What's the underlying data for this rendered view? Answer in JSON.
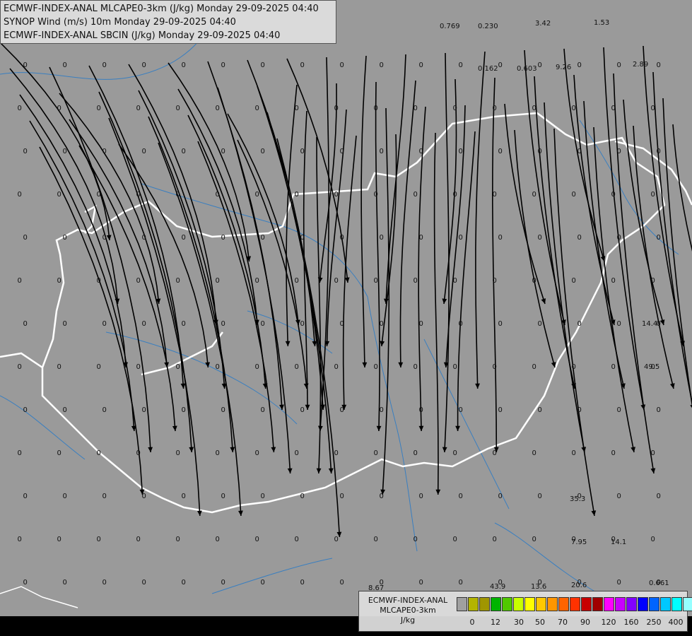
{
  "header": {
    "line1": "ECMWF-INDEX-ANAL MLCAPE0-3km (J/kg) Monday 29-09-2025 04:40",
    "line2": "SYNOP Wind (m/s) 10m Monday 29-09-2025 04:40",
    "line3": "ECMWF-INDEX-ANAL SBCIN (J/kg) Monday 29-09-2025 04:40"
  },
  "legend": {
    "title1": "ECMWF-INDEX-ANAL",
    "title2": "MLCAPE0-3km",
    "unit": "J/kg",
    "colors": [
      "#a0a0a0",
      "#b4b400",
      "#a09600",
      "#00b400",
      "#50c800",
      "#c8ff00",
      "#ffff00",
      "#ffc800",
      "#ff9600",
      "#ff6400",
      "#ff3200",
      "#c80000",
      "#a00000",
      "#ff00ff",
      "#c800ff",
      "#8200ff",
      "#0000ff",
      "#0064ff",
      "#00c8ff",
      "#00ffff",
      "#96ffff",
      "#ffffff"
    ],
    "ticks": [
      "0",
      "12",
      "30",
      "50",
      "70",
      "90",
      "120",
      "160",
      "250",
      "400"
    ]
  },
  "colors": {
    "background": "#9a9a9a",
    "border": "#ffffff",
    "river": "#3a7fc0",
    "streamline": "#000000"
  },
  "labels": {
    "zeros_note": "0",
    "values": [
      "0.769",
      "0.230",
      "3.42",
      "1.53",
      "0.162",
      "0.603",
      "9.26",
      "2.89",
      "14.4",
      "49.5",
      "35.3",
      "7.95",
      "14.1",
      "8.67",
      "43.9",
      "13.6",
      "20.6",
      "0.661"
    ]
  }
}
